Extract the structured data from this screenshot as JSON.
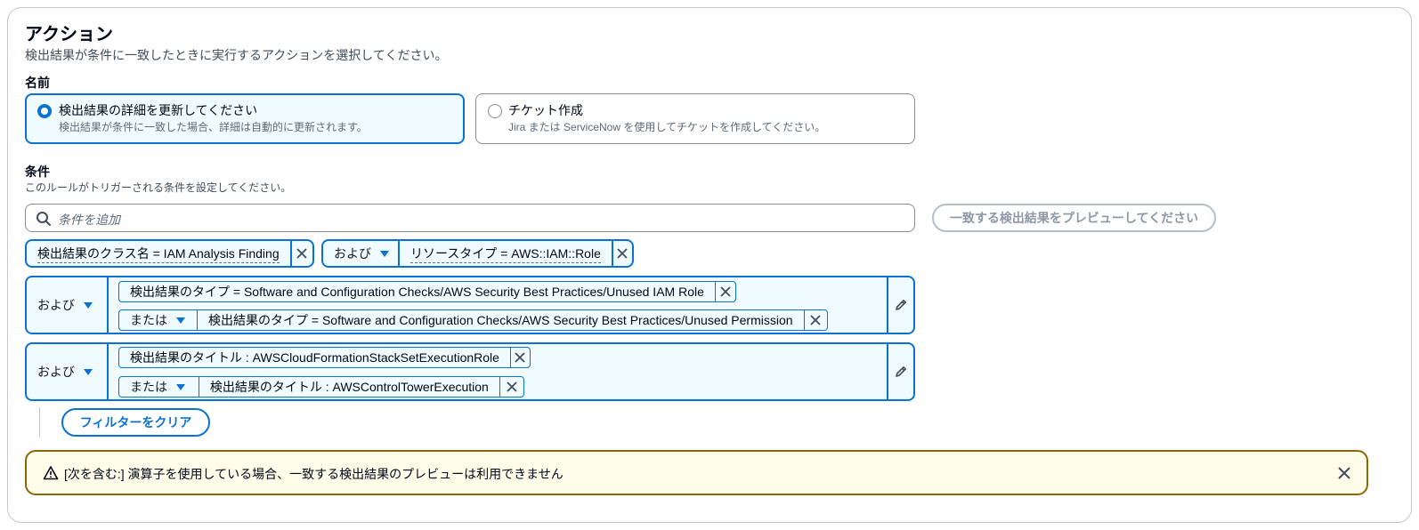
{
  "section": {
    "title": "アクション",
    "description": "検出結果が条件に一致したときに実行するアクションを選択してください。"
  },
  "name_field": {
    "label": "名前",
    "options": [
      {
        "title": "検出結果の詳細を更新してください",
        "description": "検出結果が条件に一致した場合、詳細は自動的に更新されます。",
        "selected": true
      },
      {
        "title": "チケット作成",
        "description": "Jira または ServiceNow を使用してチケットを作成してください。",
        "selected": false
      }
    ]
  },
  "conditions": {
    "label": "条件",
    "description": "このルールがトリガーされる条件を設定してください。",
    "search_placeholder": "条件を追加",
    "preview_button": "一致する検出結果をプレビューしてください",
    "token1": "検出結果のクラス名 = IAM Analysis Finding",
    "token2_op": "および",
    "token2": "リソースタイプ = AWS::IAM::Role",
    "group1": {
      "operator": "および",
      "items": [
        {
          "text": "検出結果のタイプ = Software and Configuration Checks/AWS Security Best Practices/Unused IAM Role"
        },
        {
          "op": "または",
          "text": "検出結果のタイプ = Software and Configuration Checks/AWS Security Best Practices/Unused Permission"
        }
      ]
    },
    "group2": {
      "operator": "および",
      "items": [
        {
          "text": "検出結果のタイトル : AWSCloudFormationStackSetExecutionRole"
        },
        {
          "op": "または",
          "text": "検出結果のタイトル : AWSControlTowerExecution"
        }
      ]
    },
    "clear_button": "フィルターをクリア"
  },
  "warning": {
    "text": "[次を含む:] 演算子を使用している場合、一致する検出結果のプレビューは利用できません"
  },
  "colors": {
    "accent": "#0972d3",
    "selected_bg": "#f0fbff",
    "warning_border": "#8d6605",
    "warning_bg": "#fffce9"
  }
}
